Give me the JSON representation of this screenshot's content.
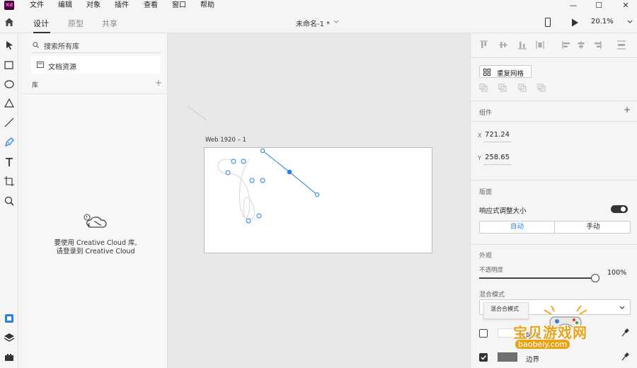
{
  "app": {
    "logo": "Xd",
    "doc_title": "未命名-1 *",
    "zoom": "20.1%"
  },
  "menu": [
    "文件",
    "编辑",
    "对象",
    "插件",
    "查看",
    "窗口",
    "帮助"
  ],
  "tabs": [
    "设计",
    "原型",
    "共享"
  ],
  "libraries": {
    "search_placeholder": "搜索所有库",
    "doc_assets": "文档资源",
    "lib_label": "库",
    "cc_message_line1": "要使用 Creative Cloud 库,",
    "cc_message_line2": "请登录到 Creative Cloud"
  },
  "canvas": {
    "artboard_label": "Web 1920 – 1"
  },
  "right": {
    "repeat_grid": "重复网格",
    "component_label": "组件",
    "x_label": "X",
    "x_value": "721.24",
    "y_label": "Y",
    "y_value": "258.65",
    "layout_label": "版面",
    "responsive_label": "响应式调整大小",
    "auto_label": "自动",
    "manual_label": "手动",
    "appearance_label": "外观",
    "opacity_label": "不透明度",
    "opacity_value": "100%",
    "opacity_fraction": 1.0,
    "blend_label": "混合模式",
    "blend_value": "混合合模式",
    "fill_label": "填充",
    "border_label": "边界"
  },
  "colors": {
    "accent": "#2680eb",
    "logo_bg": "#470137",
    "logo_fg": "#ff61f6"
  },
  "watermark": {
    "text": "宝贝游戏网",
    "url": "baobeiy.com"
  }
}
